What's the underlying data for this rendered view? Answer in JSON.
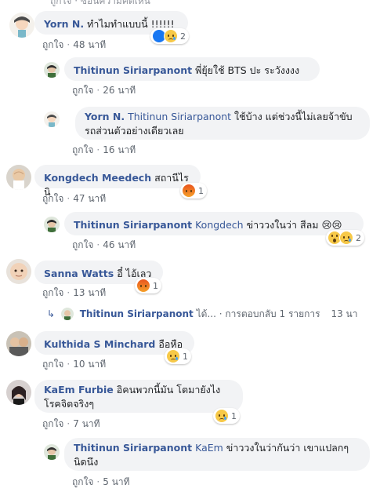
{
  "top_cut": "ถูกใจ · ซ่อนความคิดเห็น",
  "comments": [
    {
      "name": "Yorn N.",
      "text": "ทำไมทำแบบนี้ !!!!!!",
      "like": "ถูกใจ",
      "time": "48 นาที",
      "reaction_count": "2"
    },
    {
      "name": "Thitinun Siriarpanont",
      "text": "พี่ยุ้ยใช้ BTS ปะ ระวังงงง",
      "like": "ถูกใจ",
      "time": "26 นาที"
    },
    {
      "name": "Yorn N.",
      "mention": "Thitinun Siriarpanont",
      "text_line1": "ใช้บ้าง แต่ช่วงนี้ไม่เลยจ้าขับ",
      "text_line2": "รถส่วนตัวอย่างเดียวเลย",
      "like": "ถูกใจ",
      "time": "16 นาที"
    },
    {
      "name": "Kongdech Meedech",
      "text": "สถานีไรนิ",
      "like": "ถูกใจ",
      "time": "47 นาที",
      "reaction_count": "1"
    },
    {
      "name": "Thitinun Siriarpanont",
      "mention": "Kongdech",
      "text": "ข่าววงในว่า สีลม 😢😢",
      "like": "ถูกใจ",
      "time": "46 นาที",
      "reaction_count": "2"
    },
    {
      "name": "Sanna Watts",
      "text": "อี๋ ไอ้เลว",
      "like": "ถูกใจ",
      "time": "13 นาที",
      "reaction_count": "1"
    },
    {
      "name": "Kulthida S Minchard",
      "text": "อือหือ",
      "like": "ถูกใจ",
      "time": "10 นาที",
      "reaction_count": "1"
    },
    {
      "name": "KaEm Furbie",
      "text_line1": "อิคนพวกนี้มัน โตมายังไง",
      "text_line2": "โรคจิตจริงๆ",
      "like": "ถูกใจ",
      "time": "7 นาที",
      "reaction_count": "1"
    },
    {
      "name": "Thitinun Siriarpanont",
      "mention": "KaEm",
      "text_line1": "ข่าววงในว่ากันว่า เขาแปลกๆ",
      "text_line2": "นิดนึง",
      "like": "ถูกใจ",
      "time": "5 นาที"
    }
  ],
  "reply_summary": {
    "name": "Thitinun Siriarpanont",
    "suffix": "ได้...",
    "replies": "การตอบกลับ 1 รายการ",
    "time": "13 นา"
  }
}
